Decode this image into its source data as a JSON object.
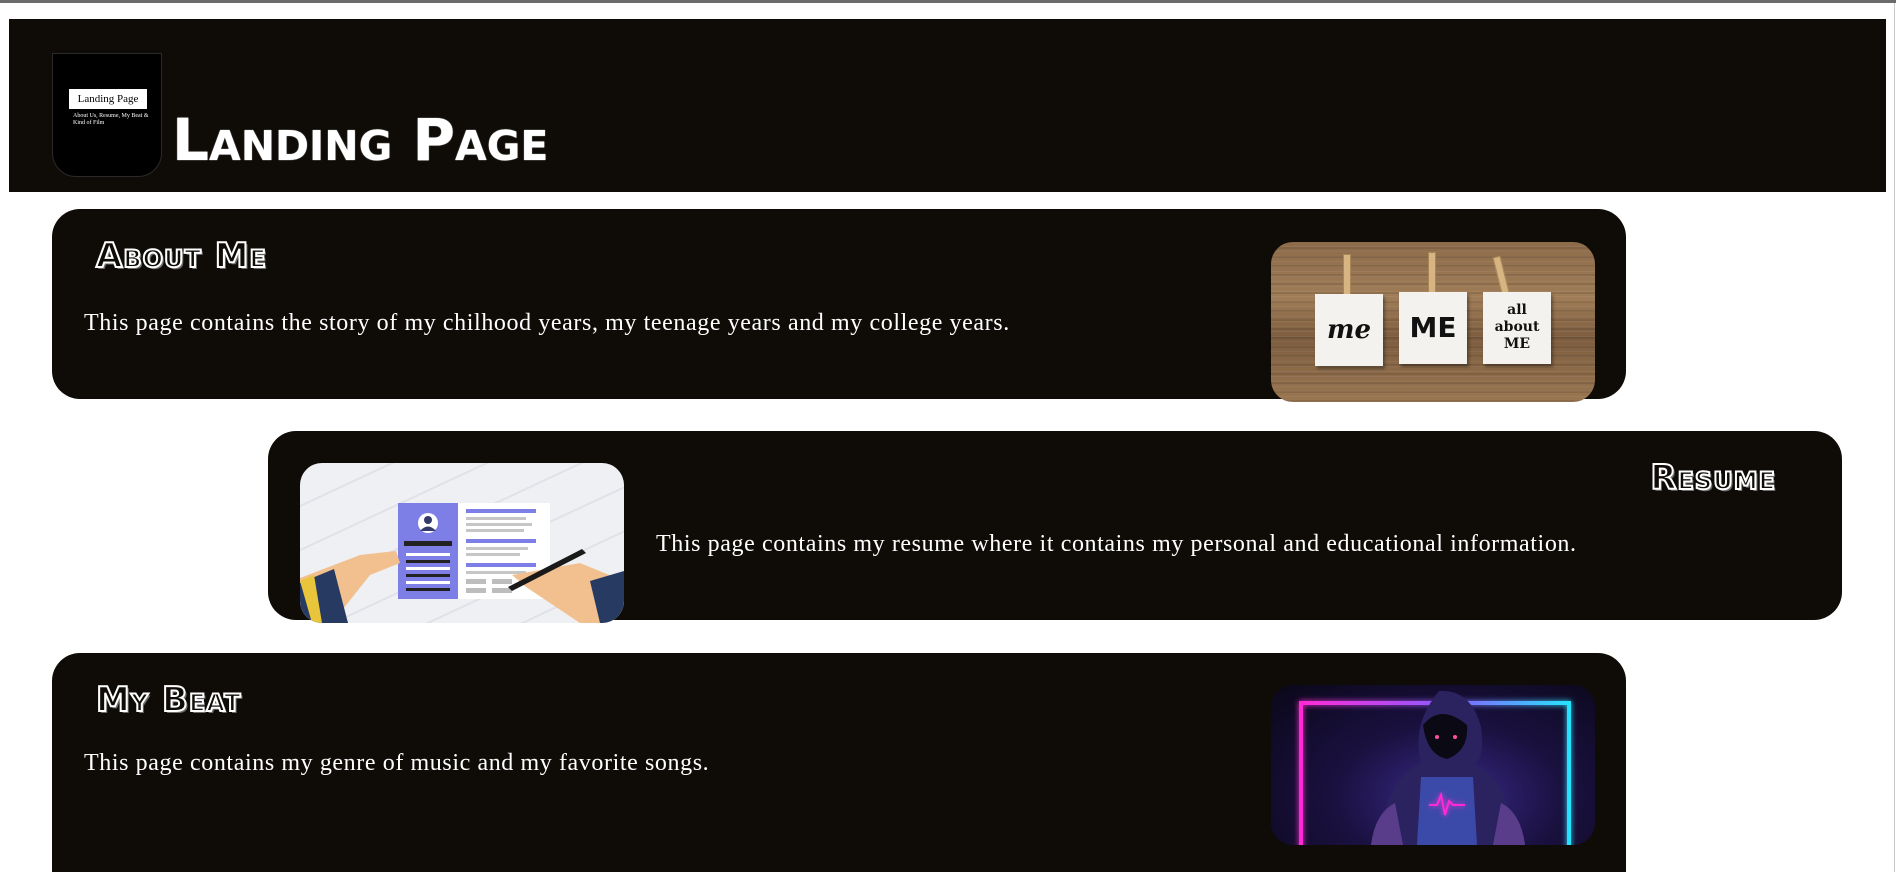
{
  "header": {
    "title": "Landing Page",
    "logo": {
      "title": "Landing Page",
      "subtitle": "About Us, Resume, My Beat & Kind of Film"
    }
  },
  "cards": [
    {
      "title": "About Me",
      "text": "This page contains the story of my chilhood years, my teenage years and my college years.",
      "image": {
        "notes": [
          "me",
          "ME",
          "all about ME"
        ]
      }
    },
    {
      "title": "Resume",
      "text": "This page contains my resume where it contains my personal and educational information."
    },
    {
      "title": "My Beat",
      "text": "This page contains my genre of music and my favorite songs."
    }
  ],
  "colors": {
    "panel": "#0f0c08",
    "text": "#ffffff",
    "neon_pink": "#ff2bd6",
    "neon_cyan": "#27e3ff",
    "resume_purple": "#7e7fe6"
  }
}
